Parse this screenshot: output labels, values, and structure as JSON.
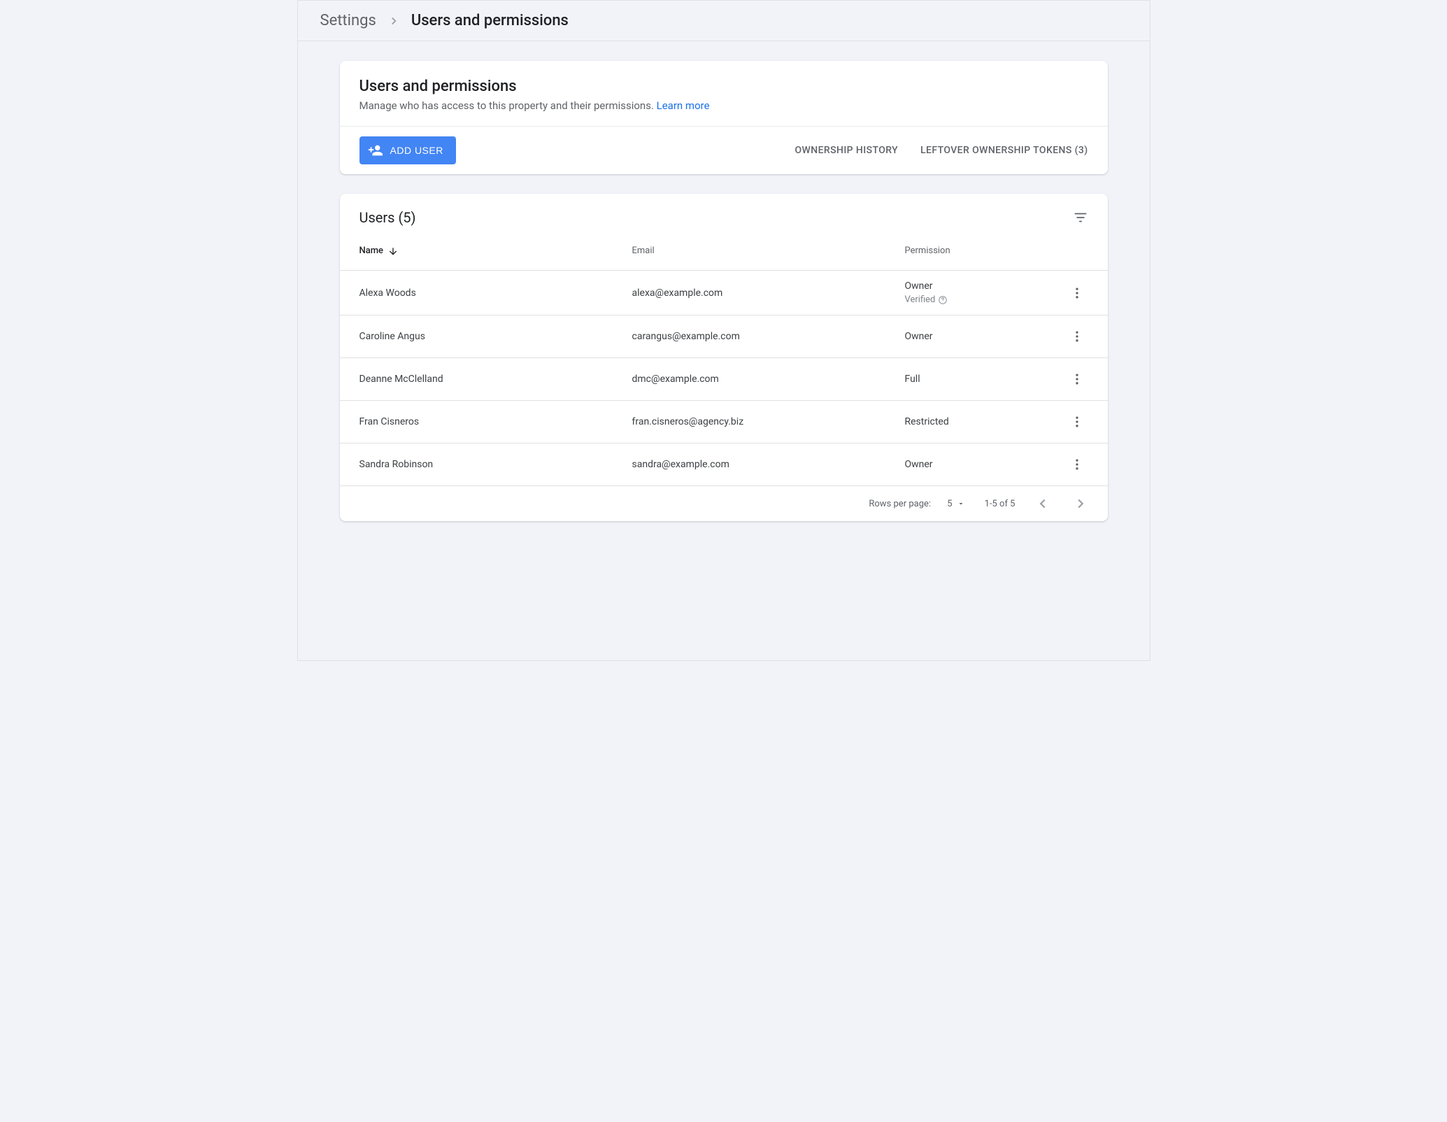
{
  "breadcrumb": {
    "parent": "Settings",
    "current": "Users and permissions"
  },
  "header_card": {
    "title": "Users and permissions",
    "subtitle_text": "Manage who has access to this property and their permissions. ",
    "learn_more": "Learn more",
    "add_user_label": "ADD USER",
    "ownership_history": "OWNERSHIP HISTORY",
    "leftover_tokens": "LEFTOVER OWNERSHIP TOKENS (3)"
  },
  "users_table": {
    "title": "Users (5)",
    "columns": {
      "name": "Name",
      "email": "Email",
      "permission": "Permission"
    },
    "rows": [
      {
        "name": "Alexa Woods",
        "email": "alexa@example.com",
        "permission": "Owner",
        "sub": "Verified"
      },
      {
        "name": "Caroline Angus",
        "email": "carangus@example.com",
        "permission": "Owner",
        "sub": ""
      },
      {
        "name": "Deanne McClelland",
        "email": "dmc@example.com",
        "permission": "Full",
        "sub": ""
      },
      {
        "name": "Fran Cisneros",
        "email": "fran.cisneros@agency.biz",
        "permission": "Restricted",
        "sub": ""
      },
      {
        "name": "Sandra Robinson",
        "email": "sandra@example.com",
        "permission": "Owner",
        "sub": ""
      }
    ]
  },
  "pagination": {
    "rows_per_page_label": "Rows per page:",
    "rows_per_page_value": "5",
    "range": "1-5 of 5"
  }
}
